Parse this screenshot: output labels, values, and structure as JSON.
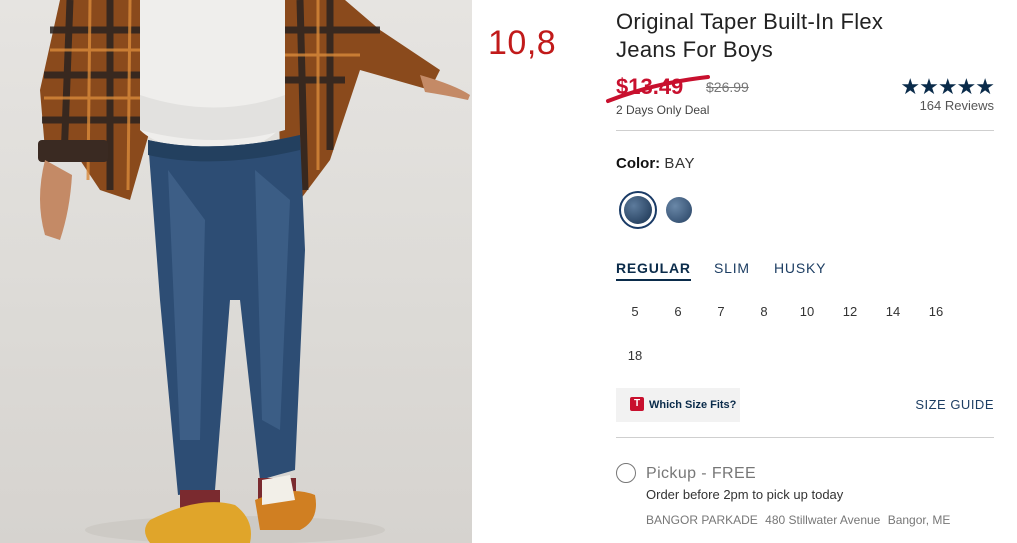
{
  "annotation": "10,8",
  "product": {
    "title_line1": "Original Taper Built-In Flex",
    "title_line2": "Jeans For Boys",
    "sale_price": "$13.49",
    "original_price": "$26.99",
    "deal_text": "2 Days Only Deal",
    "rating_stars": "★★★★★",
    "rating_value": 5,
    "reviews": "164 Reviews"
  },
  "color": {
    "label": "Color:",
    "value": "BAY",
    "swatches": [
      "bay-selected-swatch",
      "dark-wash-swatch"
    ],
    "colors": {
      "swatch_selected": "#2c4766",
      "swatch_other": "#3a5677"
    }
  },
  "fit": {
    "tabs": [
      "REGULAR",
      "SLIM",
      "HUSKY"
    ],
    "selected": "REGULAR"
  },
  "sizes": [
    "5",
    "6",
    "7",
    "8",
    "10",
    "12",
    "14",
    "16",
    "18"
  ],
  "size_finder": {
    "logo": "T",
    "label": "Which Size Fits?"
  },
  "size_guide": "SIZE GUIDE",
  "pickup": {
    "title": "Pickup - FREE",
    "note": "Order before 2pm to pick up today",
    "store_name": "BANGOR PARKADE",
    "store_address": "480 Stillwater Avenue",
    "store_city": "Bangor, ME"
  },
  "theme": {
    "accent": "#0a2b4a",
    "sale": "#c8102e",
    "annotation": "#c11a1a"
  }
}
